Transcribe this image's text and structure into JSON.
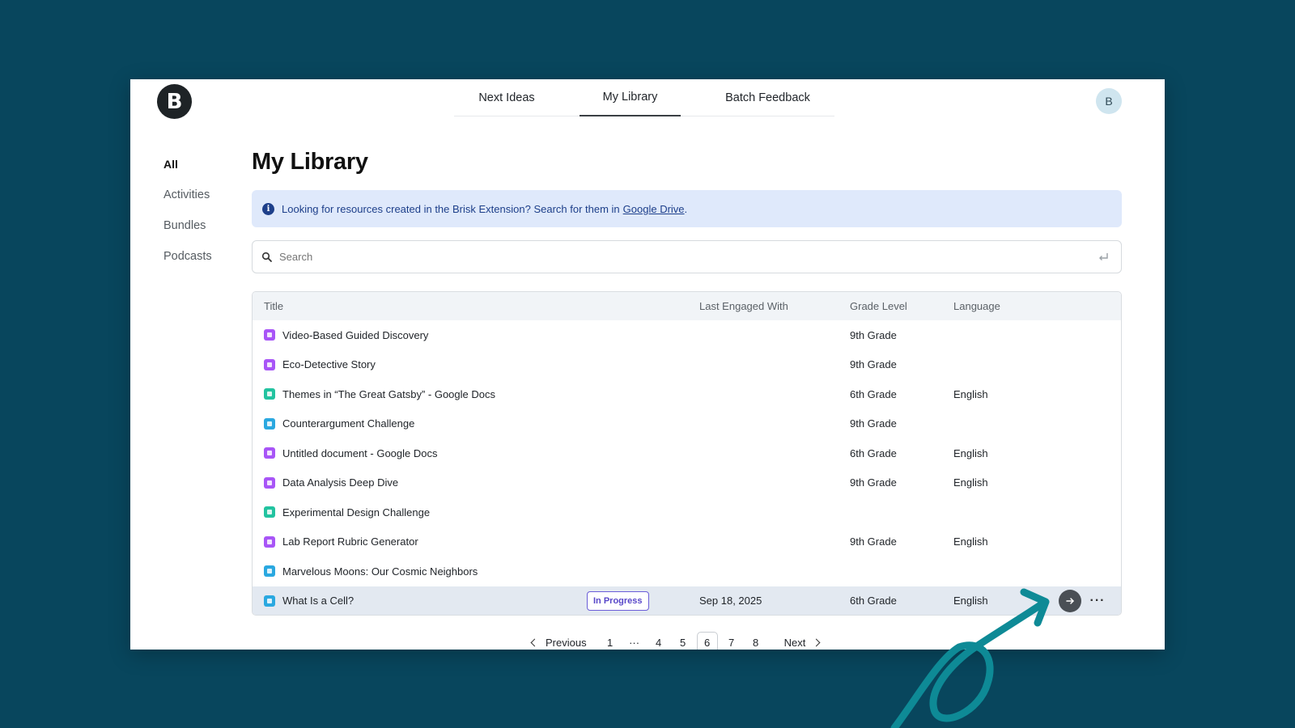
{
  "app": {
    "logo_letter": "B",
    "user_initial": "B"
  },
  "top_nav": {
    "tabs": [
      "Next Ideas",
      "My Library",
      "Batch Feedback"
    ],
    "active": "My Library"
  },
  "side_nav": {
    "items": [
      "All",
      "Activities",
      "Bundles",
      "Podcasts"
    ],
    "active": "All"
  },
  "page": {
    "title": "My Library"
  },
  "banner": {
    "text": "Looking for resources created in the Brisk Extension? Search for them in",
    "link": "Google Drive",
    "suffix": "."
  },
  "search": {
    "placeholder": "Search"
  },
  "table": {
    "headers": {
      "title": "Title",
      "last_engaged": "Last Engaged With",
      "grade": "Grade Level",
      "language": "Language"
    },
    "rows": [
      {
        "title": "Video-Based Guided Discovery",
        "icon": "rocket-icon",
        "icon_color": "#a855f7",
        "status": "",
        "date": "",
        "grade": "9th Grade",
        "language": ""
      },
      {
        "title": "Eco-Detective Story",
        "icon": "rocket-icon",
        "icon_color": "#a855f7",
        "status": "",
        "date": "",
        "grade": "9th Grade",
        "language": ""
      },
      {
        "title": "Themes in “The Great Gatsby” - Google Docs",
        "icon": "lightbulb-icon",
        "icon_color": "#22c3a0",
        "status": "",
        "date": "",
        "grade": "6th Grade",
        "language": "English"
      },
      {
        "title": "Counterargument Challenge",
        "icon": "debate-icon",
        "icon_color": "#2aa8e0",
        "status": "",
        "date": "",
        "grade": "9th Grade",
        "language": ""
      },
      {
        "title": "Untitled document - Google Docs",
        "icon": "music-note-icon",
        "icon_color": "#a855f7",
        "status": "",
        "date": "",
        "grade": "6th Grade",
        "language": "English"
      },
      {
        "title": "Data Analysis Deep Dive",
        "icon": "rocket-icon",
        "icon_color": "#a855f7",
        "status": "",
        "date": "",
        "grade": "9th Grade",
        "language": "English"
      },
      {
        "title": "Experimental Design Challenge",
        "icon": "chat-icon",
        "icon_color": "#22c3a0",
        "status": "",
        "date": "",
        "grade": "",
        "language": ""
      },
      {
        "title": "Lab Report Rubric Generator",
        "icon": "rocket-icon",
        "icon_color": "#a855f7",
        "status": "",
        "date": "",
        "grade": "9th Grade",
        "language": "English"
      },
      {
        "title": "Marvelous Moons: Our Cosmic Neighbors",
        "icon": "headphones-icon",
        "icon_color": "#2aa8e0",
        "status": "",
        "date": "",
        "grade": "",
        "language": ""
      },
      {
        "title": "What Is a Cell?",
        "icon": "slides-icon",
        "icon_color": "#2aa8e0",
        "status": "In Progress",
        "date": "Sep 18, 2025",
        "grade": "6th Grade",
        "language": "English"
      }
    ]
  },
  "pagination": {
    "previous": "Previous",
    "next": "Next",
    "pages": [
      "1",
      "···",
      "4",
      "5",
      "6",
      "7",
      "8"
    ],
    "current": "6"
  },
  "colors": {
    "background": "#08465d",
    "accent_arrow": "#0e8a96",
    "badge": "#5847c9",
    "banner_bg": "#dfe9fb"
  }
}
